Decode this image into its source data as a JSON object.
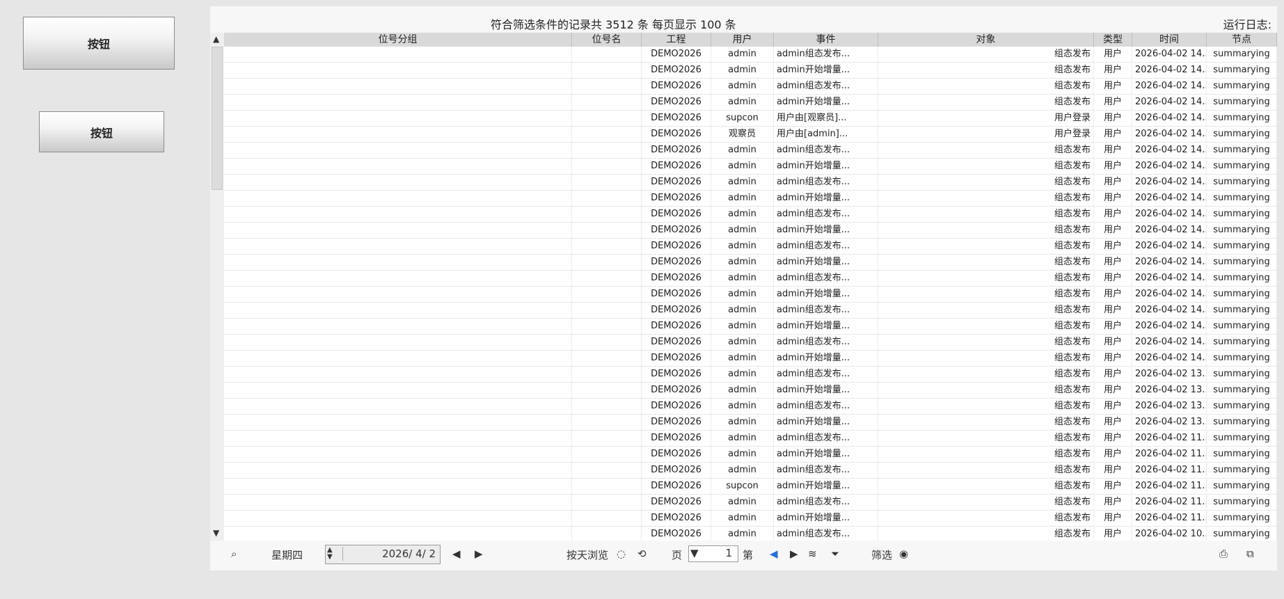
{
  "buttons": [
    {
      "label": "按钮"
    },
    {
      "label": "按钮"
    }
  ],
  "header": {
    "log_label": "运行日志:",
    "summary": "符合筛选条件的记录共 3512 条    每页显示 100 条"
  },
  "columns": [
    "节点",
    "时间",
    "类型",
    "对象",
    "事件",
    "用户",
    "工程",
    "位号名",
    "位号分组"
  ],
  "rows": [
    [
      "summarying",
      "2026-04-02 14...",
      "用户",
      "组态发布",
      "admin组态发布...",
      "admin",
      "DEMO2026",
      "",
      ""
    ],
    [
      "summarying",
      "2026-04-02 14...",
      "用户",
      "组态发布",
      "admin开始增量...",
      "admin",
      "DEMO2026",
      "",
      ""
    ],
    [
      "summarying",
      "2026-04-02 14...",
      "用户",
      "组态发布",
      "admin组态发布...",
      "admin",
      "DEMO2026",
      "",
      ""
    ],
    [
      "summarying",
      "2026-04-02 14...",
      "用户",
      "组态发布",
      "admin开始增量...",
      "admin",
      "DEMO2026",
      "",
      ""
    ],
    [
      "summarying",
      "2026-04-02 14...",
      "用户",
      "用户登录",
      "用户由[观察员]...",
      "supcon",
      "DEMO2026",
      "",
      ""
    ],
    [
      "summarying",
      "2026-04-02 14...",
      "用户",
      "用户登录",
      "用户由[admin]...",
      "观察员",
      "DEMO2026",
      "",
      ""
    ],
    [
      "summarying",
      "2026-04-02 14...",
      "用户",
      "组态发布",
      "admin组态发布...",
      "admin",
      "DEMO2026",
      "",
      ""
    ],
    [
      "summarying",
      "2026-04-02 14...",
      "用户",
      "组态发布",
      "admin开始增量...",
      "admin",
      "DEMO2026",
      "",
      ""
    ],
    [
      "summarying",
      "2026-04-02 14...",
      "用户",
      "组态发布",
      "admin组态发布...",
      "admin",
      "DEMO2026",
      "",
      ""
    ],
    [
      "summarying",
      "2026-04-02 14...",
      "用户",
      "组态发布",
      "admin开始增量...",
      "admin",
      "DEMO2026",
      "",
      ""
    ],
    [
      "summarying",
      "2026-04-02 14...",
      "用户",
      "组态发布",
      "admin组态发布...",
      "admin",
      "DEMO2026",
      "",
      ""
    ],
    [
      "summarying",
      "2026-04-02 14...",
      "用户",
      "组态发布",
      "admin开始增量...",
      "admin",
      "DEMO2026",
      "",
      ""
    ],
    [
      "summarying",
      "2026-04-02 14...",
      "用户",
      "组态发布",
      "admin组态发布...",
      "admin",
      "DEMO2026",
      "",
      ""
    ],
    [
      "summarying",
      "2026-04-02 14...",
      "用户",
      "组态发布",
      "admin开始增量...",
      "admin",
      "DEMO2026",
      "",
      ""
    ],
    [
      "summarying",
      "2026-04-02 14...",
      "用户",
      "组态发布",
      "admin组态发布...",
      "admin",
      "DEMO2026",
      "",
      ""
    ],
    [
      "summarying",
      "2026-04-02 14...",
      "用户",
      "组态发布",
      "admin开始增量...",
      "admin",
      "DEMO2026",
      "",
      ""
    ],
    [
      "summarying",
      "2026-04-02 14...",
      "用户",
      "组态发布",
      "admin组态发布...",
      "admin",
      "DEMO2026",
      "",
      ""
    ],
    [
      "summarying",
      "2026-04-02 14...",
      "用户",
      "组态发布",
      "admin开始增量...",
      "admin",
      "DEMO2026",
      "",
      ""
    ],
    [
      "summarying",
      "2026-04-02 14...",
      "用户",
      "组态发布",
      "admin组态发布...",
      "admin",
      "DEMO2026",
      "",
      ""
    ],
    [
      "summarying",
      "2026-04-02 14...",
      "用户",
      "组态发布",
      "admin开始增量...",
      "admin",
      "DEMO2026",
      "",
      ""
    ],
    [
      "summarying",
      "2026-04-02 13...",
      "用户",
      "组态发布",
      "admin组态发布...",
      "admin",
      "DEMO2026",
      "",
      ""
    ],
    [
      "summarying",
      "2026-04-02 13...",
      "用户",
      "组态发布",
      "admin开始增量...",
      "admin",
      "DEMO2026",
      "",
      ""
    ],
    [
      "summarying",
      "2026-04-02 13...",
      "用户",
      "组态发布",
      "admin组态发布...",
      "admin",
      "DEMO2026",
      "",
      ""
    ],
    [
      "summarying",
      "2026-04-02 13...",
      "用户",
      "组态发布",
      "admin开始增量...",
      "admin",
      "DEMO2026",
      "",
      ""
    ],
    [
      "summarying",
      "2026-04-02 11...",
      "用户",
      "组态发布",
      "admin组态发布...",
      "admin",
      "DEMO2026",
      "",
      ""
    ],
    [
      "summarying",
      "2026-04-02 11...",
      "用户",
      "组态发布",
      "admin开始增量...",
      "admin",
      "DEMO2026",
      "",
      ""
    ],
    [
      "summarying",
      "2026-04-02 11...",
      "用户",
      "组态发布",
      "admin组态发布...",
      "admin",
      "DEMO2026",
      "",
      ""
    ],
    [
      "summarying",
      "2026-04-02 11...",
      "用户",
      "组态发布",
      "admin开始增量...",
      "supcon",
      "DEMO2026",
      "",
      ""
    ],
    [
      "summarying",
      "2026-04-02 11...",
      "用户",
      "组态发布",
      "admin组态发布...",
      "admin",
      "DEMO2026",
      "",
      ""
    ],
    [
      "summarying",
      "2026-04-02 11...",
      "用户",
      "组态发布",
      "admin开始增量...",
      "admin",
      "DEMO2026",
      "",
      ""
    ],
    [
      "summarying",
      "2026-04-02 10...",
      "用户",
      "组态发布",
      "admin组态发布...",
      "admin",
      "DEMO2026",
      "",
      ""
    ]
  ],
  "footer": {
    "filter_label": "筛选",
    "page_prefix": "第",
    "page_value": "1",
    "page_suffix": "页",
    "by_day_label": "按天浏览",
    "date_value": "2026/ 4/ 2",
    "weekday": "星期四"
  },
  "highlight_color": "#e8413f"
}
